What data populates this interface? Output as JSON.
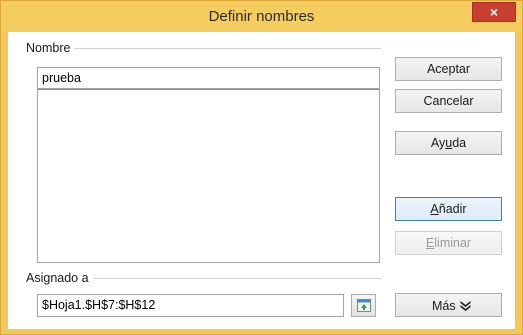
{
  "window": {
    "title": "Definir nombres",
    "close_label": "×"
  },
  "name_section": {
    "label": "Nombre",
    "input_value": "prueba"
  },
  "assigned_section": {
    "label": "Asignado a",
    "range_value": "$Hoja1.$H$7:$H$12"
  },
  "buttons": {
    "aceptar": "Aceptar",
    "cancelar": "Cancelar",
    "ayuda_pre": "Ay",
    "ayuda_ul": "u",
    "ayuda_post": "da",
    "anadir_ul": "A",
    "anadir_post": "ñadir",
    "eliminar_ul": "E",
    "eliminar_post": "liminar",
    "mas": "Más"
  },
  "icons": {
    "close": "close-icon",
    "shrink": "shrink-dialog-icon",
    "more": "double-chevron-down-icon"
  }
}
